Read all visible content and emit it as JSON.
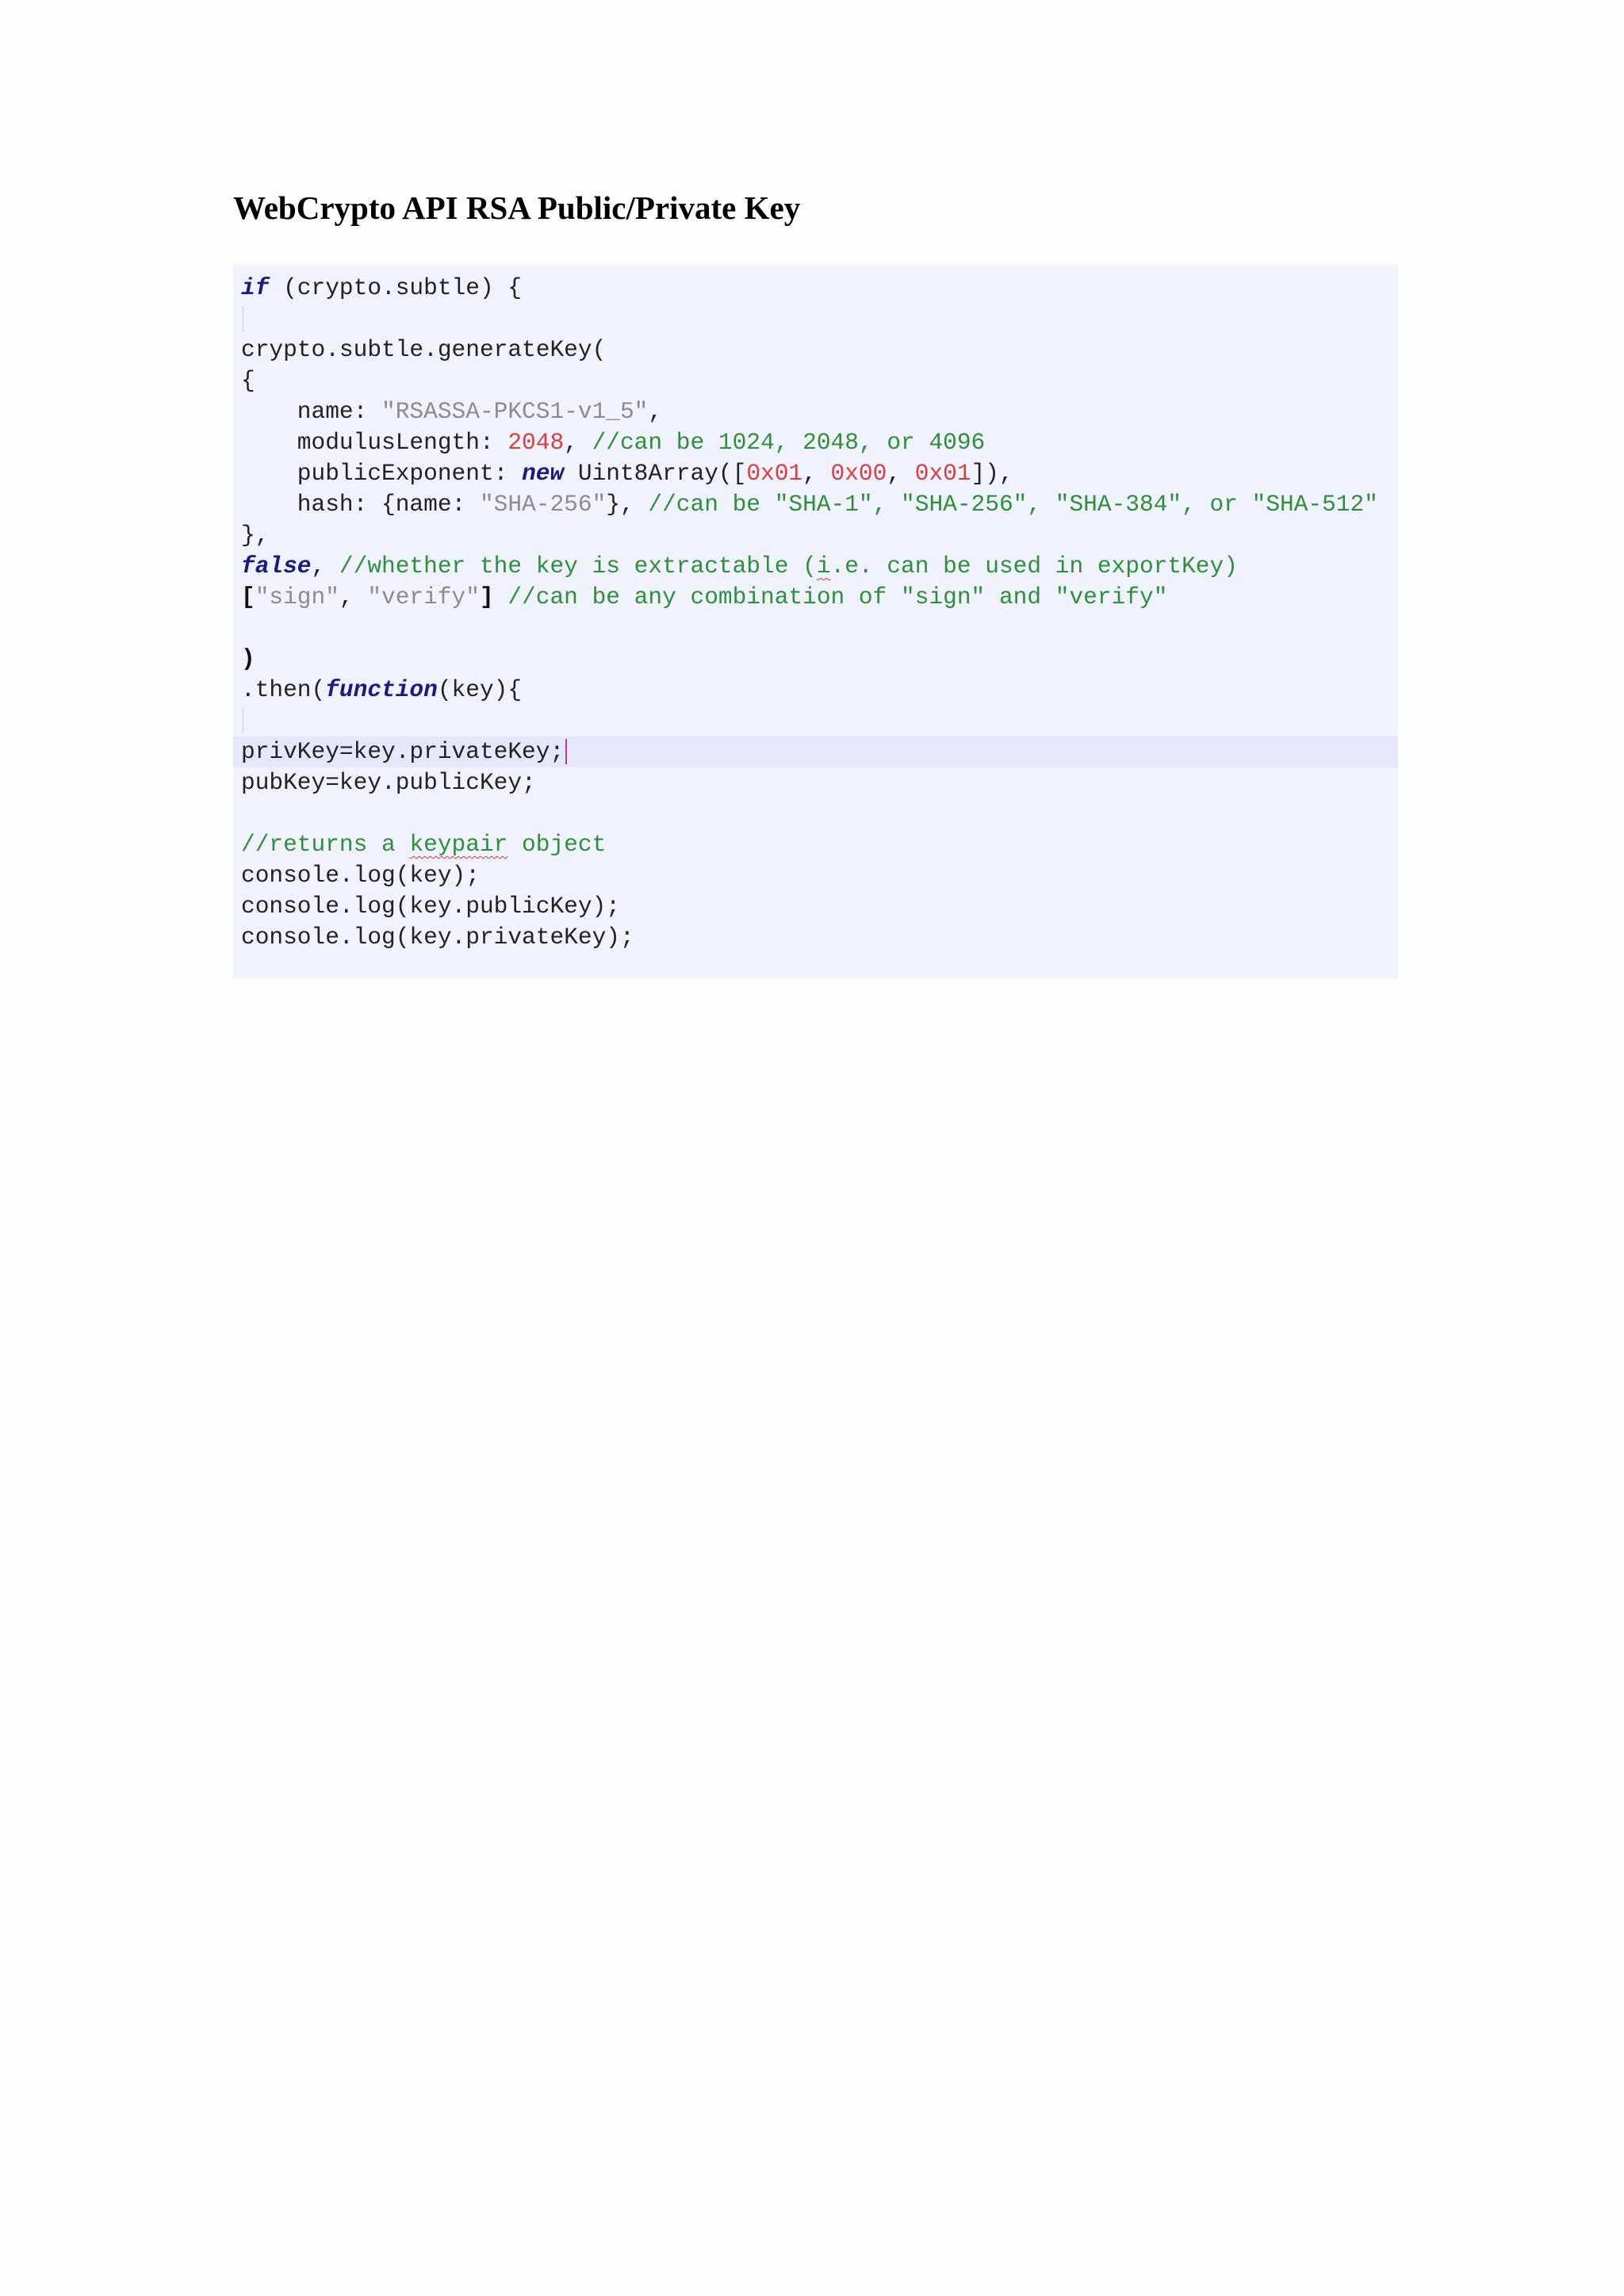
{
  "document": {
    "title": "WebCrypto API RSA Public/Private Key"
  },
  "code": {
    "l1": {
      "kw": "if",
      "rest": " (crypto.subtle) {"
    },
    "l3": {
      "text": "crypto.subtle.generateKey("
    },
    "l4": {
      "text": "{"
    },
    "l5": {
      "key": "    name: ",
      "str": "\"RSASSA-PKCS1-v1_5\"",
      "tail": ","
    },
    "l6": {
      "key": "    modulusLength: ",
      "num": "2048",
      "sep": ", ",
      "cmt": "//can be 1024, 2048, or 4096"
    },
    "l7": {
      "key": "    publicExponent: ",
      "kw": "new",
      "mid": " Uint8Array([",
      "n1": "0x01",
      "c1": ", ",
      "n2": "0x00",
      "c2": ", ",
      "n3": "0x01",
      "end": "]),"
    },
    "l8": {
      "key": "    hash: {name: ",
      "str": "\"SHA-256\"",
      "mid": "}, ",
      "cmt": "//can be \"SHA-1\", \"SHA-256\", \"SHA-384\", or \"SHA-512\""
    },
    "l9": {
      "text": "},"
    },
    "l10": {
      "kw": "false",
      "sep": ", ",
      "cmt_a": "//whether the key is extractable (",
      "cmt_i": "i",
      "cmt_b": ".e. can be used in exportKey)"
    },
    "l11": {
      "open": "[",
      "s1": "\"sign\"",
      "comma": ", ",
      "s2": "\"verify\"",
      "close": "] ",
      "cmt": "//can be any combination of \"sign\" and \"verify\""
    },
    "l13": {
      "text": ")"
    },
    "l14": {
      "pre": ".then(",
      "kw": "function",
      "post": "(key){"
    },
    "l16": {
      "text": "privKey=key.privateKey;"
    },
    "l17": {
      "text": "pubKey=key.publicKey;"
    },
    "l19": {
      "cmt_a": "//returns a ",
      "cmt_word": "keypair",
      "cmt_b": " object"
    },
    "l20": {
      "text": "console.log(key);"
    },
    "l21": {
      "text": "console.log(key.publicKey);"
    },
    "l22": {
      "text": "console.log(key.privateKey);"
    }
  }
}
